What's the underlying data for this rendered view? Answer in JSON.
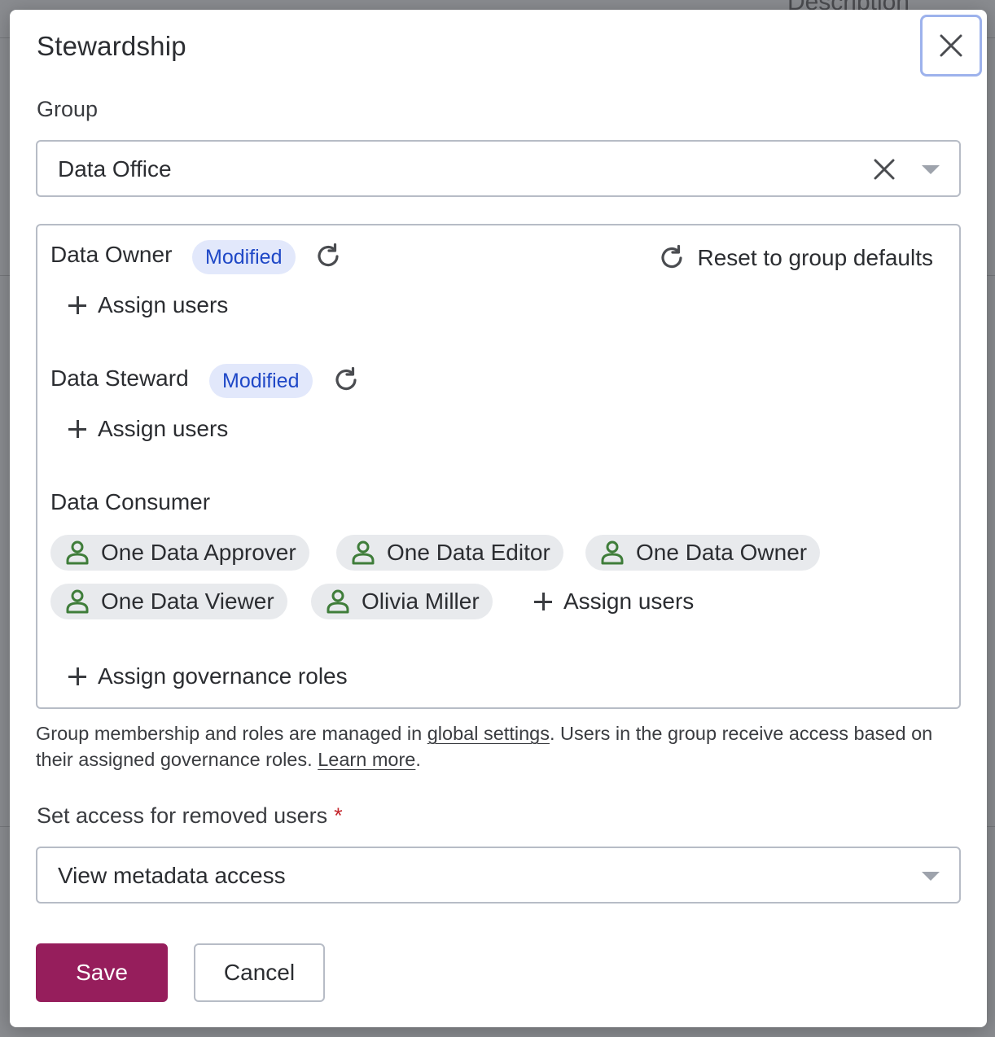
{
  "background": {
    "peek_text": "Description"
  },
  "modal": {
    "title": "Stewardship",
    "close_icon": "close-icon"
  },
  "group": {
    "label": "Group",
    "value": "Data Office",
    "clear_icon": "clear-icon",
    "caret_icon": "chevron-down-icon"
  },
  "roles": {
    "reset_all_label": "Reset to group defaults",
    "data_owner": {
      "name": "Data Owner",
      "badge": "Modified",
      "assign_label": "Assign users"
    },
    "data_steward": {
      "name": "Data Steward",
      "badge": "Modified",
      "assign_label": "Assign users"
    },
    "data_consumer": {
      "name": "Data Consumer",
      "users": [
        "One Data Approver",
        "One Data Editor",
        "One Data Owner",
        "One Data Viewer",
        "Olivia Miller"
      ],
      "assign_label": "Assign users"
    },
    "assign_governance_label": "Assign governance roles"
  },
  "help": {
    "part1": "Group membership and roles are managed in ",
    "link1": "global settings",
    "part2": ". Users in the group receive access based on their assigned governance roles. ",
    "link2": "Learn more",
    "part3": "."
  },
  "removed_access": {
    "label": "Set access for removed users",
    "required_mark": "*",
    "value": "View metadata access"
  },
  "actions": {
    "save_label": "Save",
    "cancel_label": "Cancel"
  },
  "colors": {
    "primary": "#961e5c",
    "badge_bg": "#e2e8fb",
    "badge_text": "#1f48c7",
    "user_icon": "#3f7d3a",
    "focus_ring": "#9db2ec"
  }
}
